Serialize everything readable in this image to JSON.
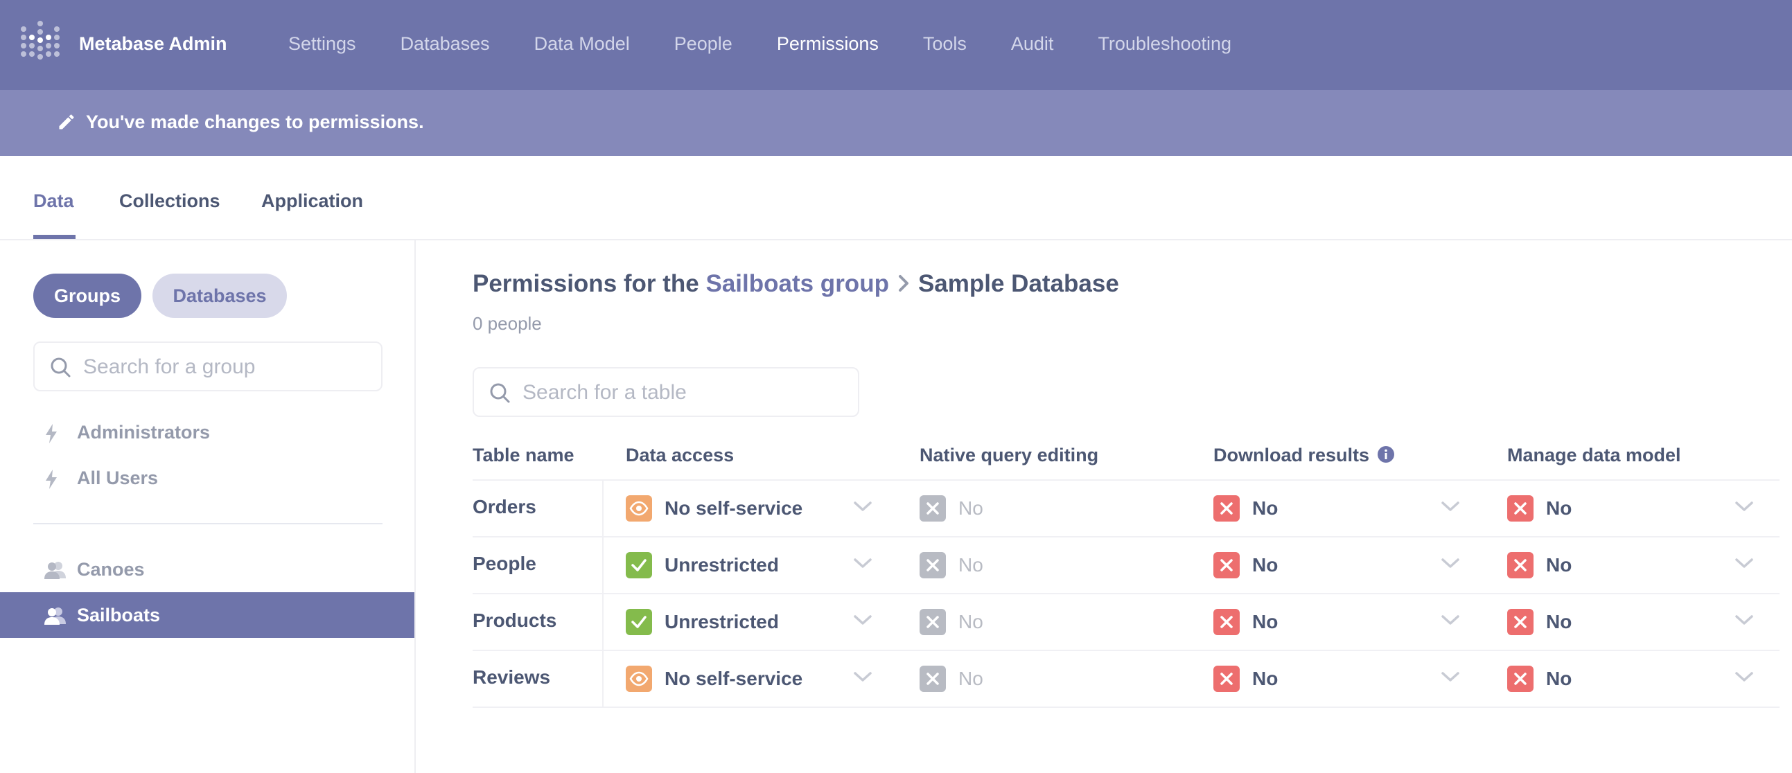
{
  "app": {
    "title": "Metabase Admin"
  },
  "nav": {
    "items": [
      {
        "label": "Settings"
      },
      {
        "label": "Databases"
      },
      {
        "label": "Data Model"
      },
      {
        "label": "People"
      },
      {
        "label": "Permissions"
      },
      {
        "label": "Tools"
      },
      {
        "label": "Audit"
      },
      {
        "label": "Troubleshooting"
      }
    ],
    "active": "Permissions"
  },
  "banner": {
    "text": "You've made changes to permissions."
  },
  "tabs": {
    "data": "Data",
    "collections": "Collections",
    "application": "Application",
    "active": "Data"
  },
  "sidebar": {
    "toggle": {
      "groups": "Groups",
      "databases": "Databases",
      "active": "Groups"
    },
    "search": {
      "placeholder": "Search for a group",
      "value": ""
    },
    "special_groups": [
      {
        "label": "Administrators",
        "icon": "bolt-icon"
      },
      {
        "label": "All Users",
        "icon": "bolt-icon"
      }
    ],
    "groups": [
      {
        "label": "Canoes",
        "icon": "group-icon"
      },
      {
        "label": "Sailboats",
        "icon": "group-icon",
        "selected": true
      }
    ]
  },
  "main": {
    "title_prefix": "Permissions for the ",
    "group_link": "Sailboats group",
    "database": "Sample Database",
    "people_count": "0 people",
    "table_search": {
      "placeholder": "Search for a table",
      "value": ""
    },
    "columns": {
      "table_name": "Table name",
      "data_access": "Data access",
      "native_query": "Native query editing",
      "download": "Download results",
      "manage_model": "Manage data model"
    },
    "rows": [
      {
        "name": "Orders",
        "data_access": "No self-service",
        "native": "No",
        "download": "No",
        "manage": "No"
      },
      {
        "name": "People",
        "data_access": "Unrestricted",
        "native": "No",
        "download": "No",
        "manage": "No"
      },
      {
        "name": "Products",
        "data_access": "Unrestricted",
        "native": "No",
        "download": "No",
        "manage": "No"
      },
      {
        "name": "Reviews",
        "data_access": "No self-service",
        "native": "No",
        "download": "No",
        "manage": "No"
      }
    ]
  },
  "colors": {
    "brand": "#6e74aa",
    "banner": "#8589ba",
    "orange": "#f2a86f",
    "green": "#84bb4c",
    "red": "#ed6e6e",
    "gray": "#b8bbc3"
  }
}
